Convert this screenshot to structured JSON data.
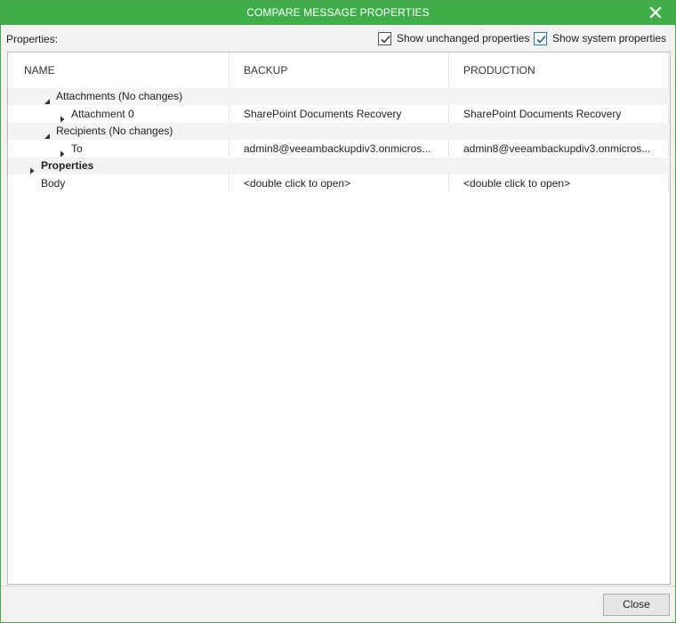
{
  "window": {
    "title": "COMPARE MESSAGE PROPERTIES"
  },
  "options": {
    "properties_label": "Properties:",
    "show_unchanged": {
      "label": "Show unchanged properties",
      "checked": true
    },
    "show_system": {
      "label": "Show system properties",
      "checked": true
    }
  },
  "table": {
    "columns": [
      "NAME",
      "BACKUP",
      "PRODUCTION"
    ],
    "rows": [
      {
        "name": "Attachments (No changes)",
        "backup": "",
        "production": "",
        "expander": "expanded",
        "indent": 1,
        "bold": false,
        "shaded": true
      },
      {
        "name": "Attachment 0",
        "backup": "SharePoint Documents Recovery",
        "production": "SharePoint Documents Recovery",
        "expander": "collapsed",
        "indent": 2,
        "bold": false,
        "shaded": false
      },
      {
        "name": "Recipients (No changes)",
        "backup": "",
        "production": "",
        "expander": "expanded",
        "indent": 1,
        "bold": false,
        "shaded": true
      },
      {
        "name": "To",
        "backup": "admin8@veeambackupdiv3.onmicros...",
        "production": "admin8@veeambackupdiv3.onmicros...",
        "expander": "collapsed",
        "indent": 2,
        "bold": false,
        "shaded": false
      },
      {
        "name": "Properties",
        "backup": "",
        "production": "",
        "expander": "collapsed",
        "indent": 0,
        "bold": true,
        "shaded": true
      },
      {
        "name": "Body",
        "backup": "<double click to open>",
        "production": "<double click to open>",
        "expander": "none",
        "indent": 0,
        "bold": false,
        "shaded": false
      }
    ]
  },
  "footer": {
    "close_label": "Close"
  },
  "colors": {
    "titlebar": "#3fae49",
    "row_shade": "#f3f3f3",
    "check_mark": "#2a5d8a"
  },
  "icons": {
    "close": "close-icon",
    "check": "check-icon",
    "expanded": "triangle-down-right-icon",
    "collapsed": "triangle-right-icon"
  }
}
